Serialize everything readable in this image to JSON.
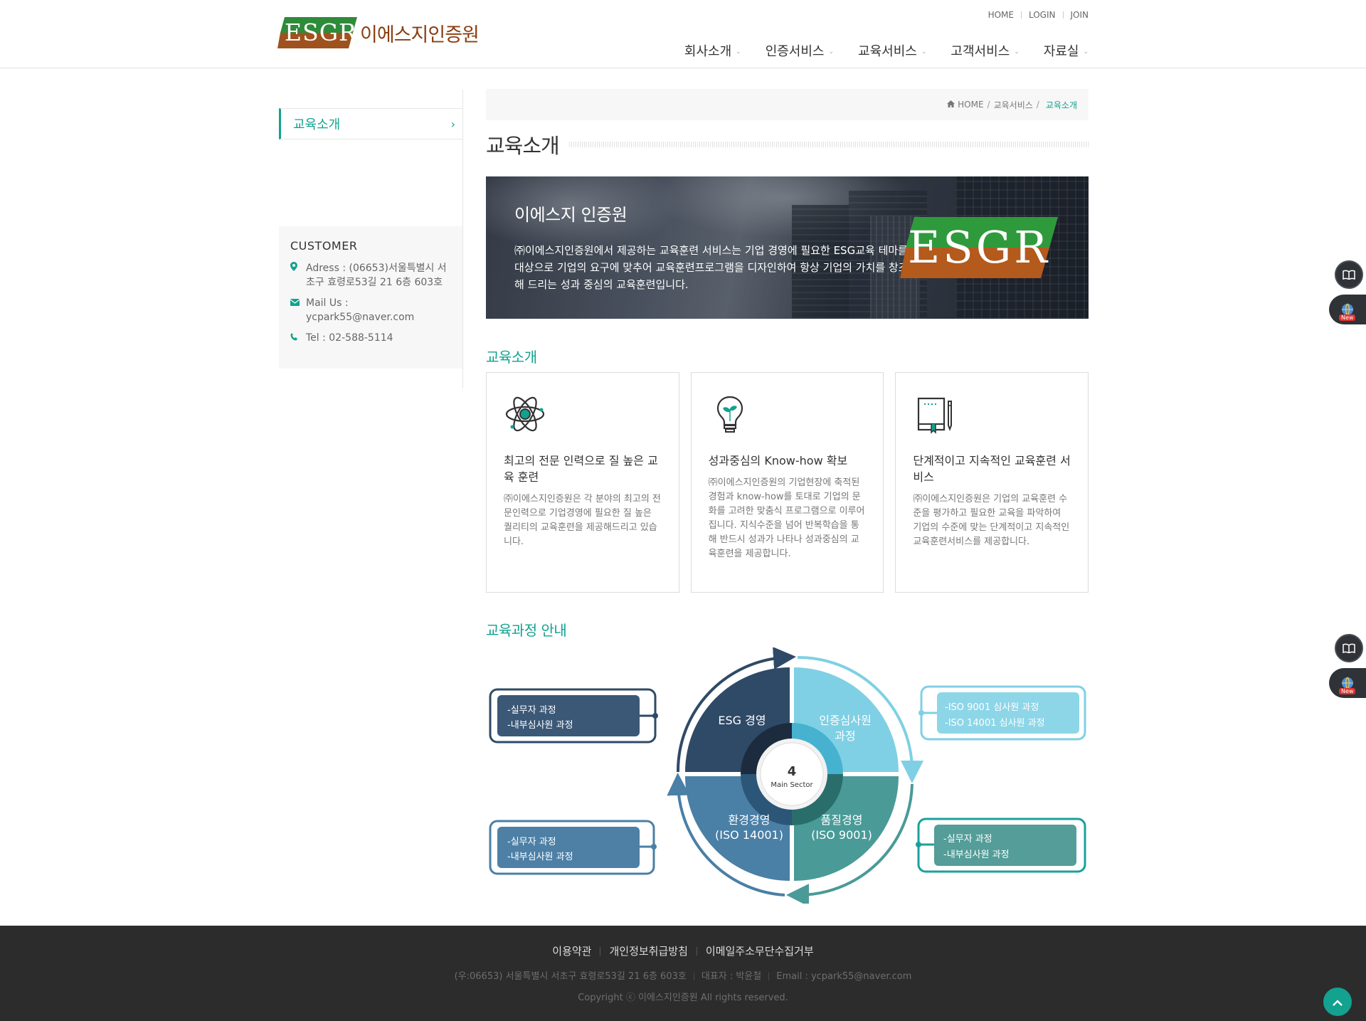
{
  "header": {
    "logo_mark": "ESGR",
    "logo_name": "이에스지인증원",
    "util": [
      "HOME",
      "LOGIN",
      "JOIN"
    ],
    "nav": [
      "회사소개",
      "인증서비스",
      "교육서비스",
      "고객서비스",
      "자료실"
    ]
  },
  "sidebar": {
    "menu_item": "교육소개",
    "customer": {
      "title": "CUSTOMER",
      "address": "Adress : (06653)서울특별시 서초구 효령로53길 21 6층 603호",
      "mail": "Mail Us : ycpark55@naver.com",
      "tel": "Tel : 02-588-5114"
    }
  },
  "breadcrumb": {
    "home": "HOME",
    "parent": "교육서비스",
    "current": "교육소개"
  },
  "page_title": "교육소개",
  "banner": {
    "title": "이에스지 인증원",
    "text": "㈜이에스지인증원에서 제공하는 교육훈련 서비스는 기업 경영에 필요한 ESG교육 테마를 대상으로 기업의 요구에 맞추어 교육훈련프로그램을 디자인하여 항상 기업의 가치를 창조해 드리는 성과 중심의 교육훈련입니다.",
    "logo_text": "ESGR"
  },
  "intro_title": "교육소개",
  "cards": [
    {
      "icon": "atom-icon",
      "title": "최고의 전문 인력으로 질 높은 교육 훈련",
      "text": "㈜이에스지인증원은 각 분야의 최고의 전문인력으로 기업경영에 필요한 질 높은 퀄리티의 교육훈련을 제공해드리고 있습니다."
    },
    {
      "icon": "lightbulb-icon",
      "title": "성과중심의 Know-how 확보",
      "text": "㈜이에스지인증원의 기업현장에 축적된 경험과 know-how를 토대로 기업의 문화를 고려한 맞춤식 프로그램으로 이루어집니다. 지식수준을 넘어 반복학습을 통해 반드시 성과가 나타나 성과중심의 교육훈련을 제공합니다."
    },
    {
      "icon": "book-icon",
      "title": "단계적이고 지속적인 교육훈련 서비스",
      "text": "㈜이에스지인증원은 기업의 교육훈련 수준을 평가하고 필요한 교육을 파악하여 기업의 수준에 맞는 단계적이고 지속적인 교육훈련서비스를 제공합니다."
    }
  ],
  "course_title": "교육과정 안내",
  "diagram": {
    "center_num": "4",
    "center_label": "Main Sector",
    "quadrants": [
      {
        "label": "ESG 경영",
        "color": "#2f4a66"
      },
      {
        "label": "인증심사원 과정",
        "color": "#7fd0e4"
      },
      {
        "label": "환경경영 (ISO 14001)",
        "color": "#4a7fa6"
      },
      {
        "label": "품질경영 (ISO 9001)",
        "color": "#4a9a98"
      }
    ],
    "boxes": [
      {
        "lines": [
          "-실무자 과정",
          "-내부심사원 과정"
        ]
      },
      {
        "lines": [
          "-ISO 9001  심사원 과정",
          "-ISO 14001 심사원 과정"
        ]
      },
      {
        "lines": [
          "-실무자 과정",
          "-내부심사원 과정"
        ]
      },
      {
        "lines": [
          "-실무자 과정",
          "-내부심사원 과정"
        ]
      }
    ]
  },
  "footer": {
    "links": [
      "이용약관",
      "개인정보취급방침",
      "이메일주소무단수집거부"
    ],
    "address": "(우:06653) 서울특별시 서초구 효령로53길 21 6층 603호",
    "ceo": "대표자 : 박윤철",
    "email": "Email : ycpark55@naver.com",
    "copyright": "Copyright ⓒ 이에스지인증원 All rights reserved."
  },
  "floating": {
    "new_badge": "New"
  },
  "colors": {
    "accent": "#12a28f",
    "footer_bg": "#2c2c2c"
  }
}
